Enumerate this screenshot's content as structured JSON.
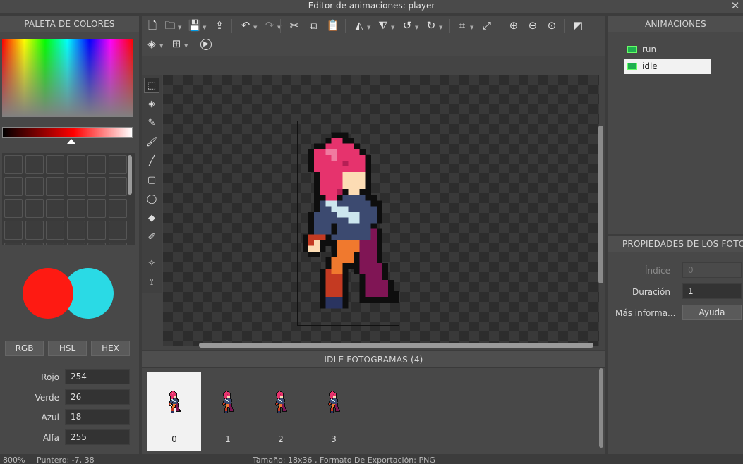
{
  "window": {
    "title": "Editor de animaciones: player",
    "close_icon": "✕"
  },
  "palette": {
    "header": "PALETA DE COLORES",
    "primary_color": "#fe1a12",
    "secondary_color": "#2adae5",
    "modes": [
      "RGB",
      "HSL",
      "HEX"
    ],
    "fields": [
      {
        "label": "Rojo",
        "value": "254"
      },
      {
        "label": "Verde",
        "value": "26"
      },
      {
        "label": "Azul",
        "value": "18"
      },
      {
        "label": "Alfa",
        "value": "255"
      }
    ]
  },
  "toolbar": {
    "icons": [
      "new-file-icon",
      "open-folder-icon",
      "save-icon",
      "export-icon",
      "undo-icon",
      "redo-icon",
      "cut-icon",
      "copy-icon",
      "paste-icon",
      "flip-horizontal-icon",
      "flip-vertical-icon",
      "rotate-left-icon",
      "rotate-right-icon",
      "crop-icon",
      "resize-icon",
      "zoom-in-icon",
      "zoom-out-icon",
      "zoom-fit-icon",
      "onion-skin-icon",
      "layers-icon",
      "grid-icon",
      "play-icon"
    ]
  },
  "tools": [
    "select-tool-icon",
    "eraser-tool-icon",
    "pencil-tool-icon",
    "brush-tool-icon",
    "line-tool-icon",
    "rectangle-tool-icon",
    "ellipse-tool-icon",
    "fill-tool-icon",
    "eyedropper-tool-icon",
    "move-point-tool-icon",
    "bone-tool-icon"
  ],
  "frames": {
    "header": "IDLE FOTOGRAMAS (4)",
    "items": [
      "0",
      "1",
      "2",
      "3"
    ],
    "selected": 0
  },
  "animations": {
    "header": "ANIMACIONES",
    "items": [
      {
        "name": "run"
      },
      {
        "name": "idle"
      }
    ],
    "selected": "idle"
  },
  "properties": {
    "header": "PROPIEDADES DE LOS FOTOGRAMAS",
    "index_label": "Índice",
    "index_placeholder": "0",
    "duration_label": "Duración",
    "duration_value": "1",
    "more_label": "Más informa...",
    "help_label": "Ayuda"
  },
  "status": {
    "zoom": "800%",
    "pointer": "Puntero: -7, 38",
    "info": "Tamaño: 18x36 , Formato De Exportación: PNG"
  }
}
